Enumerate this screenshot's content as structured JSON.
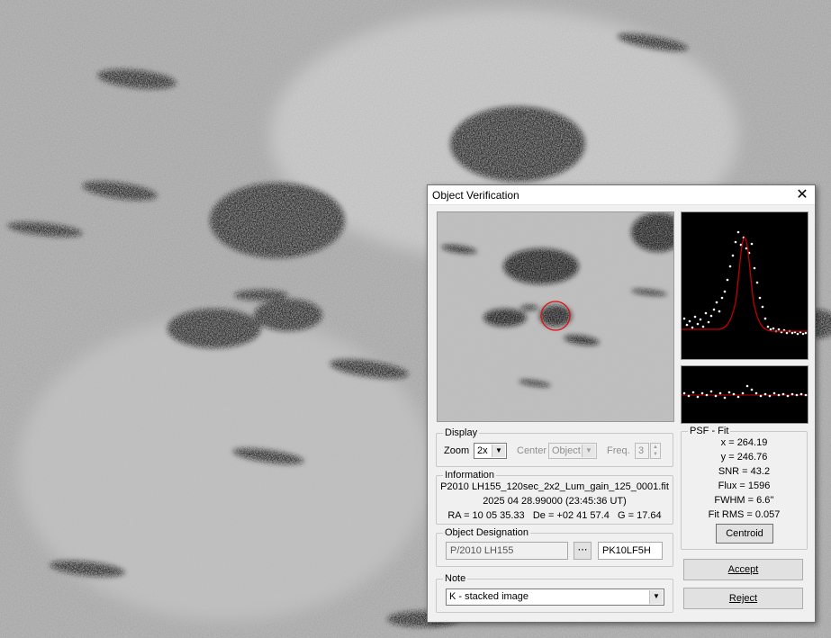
{
  "dialog": {
    "title": "Object Verification",
    "close_glyph": "✕"
  },
  "display": {
    "legend": "Display",
    "zoom_label": "Zoom",
    "zoom_value": "2x",
    "center_label": "Center",
    "center_value": "Object",
    "freq_label": "Freq.",
    "freq_value": "3"
  },
  "information": {
    "legend": "Information",
    "filename": "P2010 LH155_120sec_2x2_Lum_gain_125_0001.fit",
    "datetime": "2025 04 28.99000 (23:45:36 UT)",
    "coords": "RA = 10 05 35.33   De = +02 41 57.4   G = 17.64"
  },
  "designation": {
    "legend": "Object Designation",
    "name": "P/2010 LH155",
    "code": "PK10LF5H"
  },
  "note": {
    "legend": "Note",
    "value": "K - stacked image"
  },
  "psf": {
    "legend": "PSF - Fit",
    "x": "x = 264.19",
    "y": "y = 246.76",
    "snr": "SNR = 43.2",
    "flux": "Flux = 1596",
    "fwhm": "FWHM = 6.6''",
    "rms": "Fit RMS = 0.057",
    "centroid_label": "Centroid"
  },
  "buttons": {
    "accept": "Accept",
    "reject": "Reject"
  },
  "colors": {
    "psf_curve": "#c00000",
    "target_circle": "#e01010",
    "sky_background": "#bdbdbd"
  }
}
